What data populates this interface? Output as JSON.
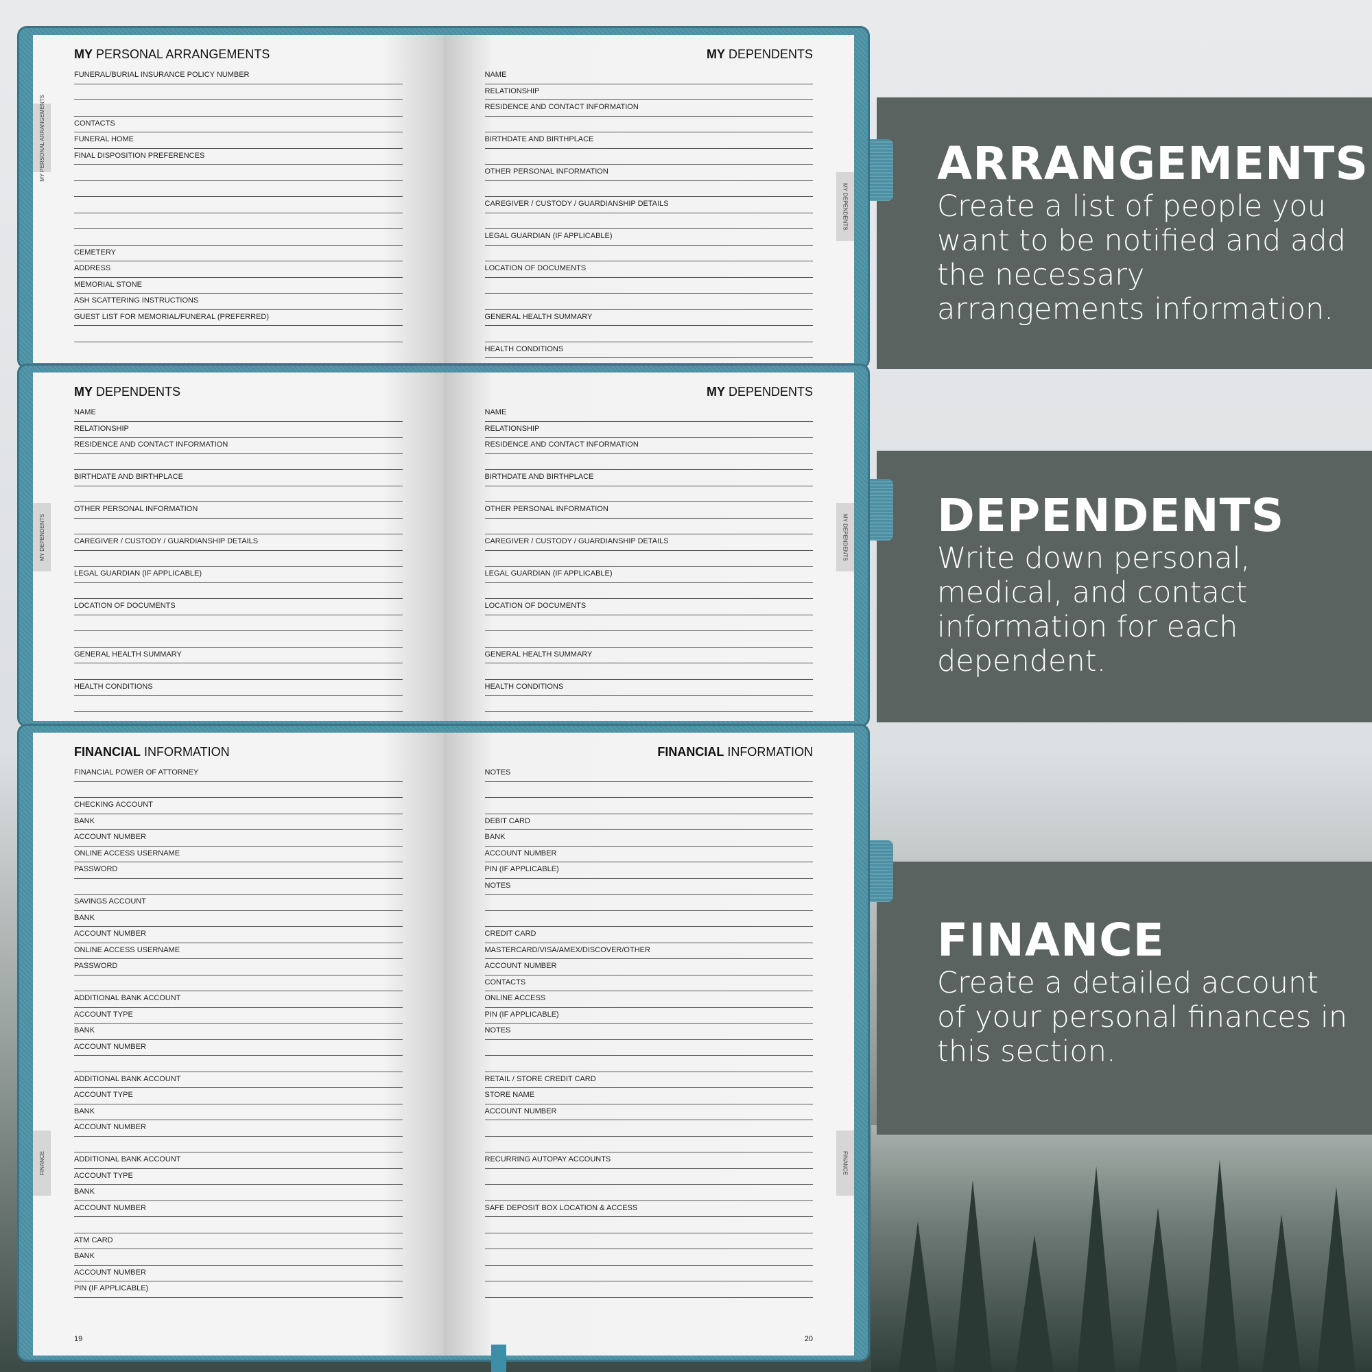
{
  "panels": [
    {
      "title": "ARRANGEMENTS",
      "text": "Create a list of people you want to be notified and add the necessary arrangements information."
    },
    {
      "title": "DEPENDENTS",
      "text": "Write down personal, medical, and contact information for each dependent."
    },
    {
      "title": "FINANCE",
      "text": "Create a detailed account of your personal finances in this section."
    }
  ],
  "spread1": {
    "left": {
      "title_bold": "MY",
      "title_rest": " PERSONAL ARRANGEMENTS",
      "side": "MY PERSONAL ARRANGEMENTS",
      "fields": [
        "FUNERAL/BURIAL INSURANCE POLICY NUMBER",
        "",
        "",
        "CONTACTS",
        "FUNERAL HOME",
        "FINAL DISPOSITION PREFERENCES",
        "",
        "",
        "",
        "",
        "",
        "CEMETERY",
        "ADDRESS",
        "MEMORIAL STONE",
        "ASH SCATTERING INSTRUCTIONS",
        "GUEST LIST FOR MEMORIAL/FUNERAL (PREFERRED)",
        ""
      ]
    },
    "right": {
      "title_bold": "MY",
      "title_rest": " DEPENDENTS",
      "side": "MY DEPENDENTS",
      "fields": [
        "NAME",
        "RELATIONSHIP",
        "RESIDENCE AND CONTACT INFORMATION",
        "",
        "BIRTHDATE AND BIRTHPLACE",
        "",
        "OTHER PERSONAL INFORMATION",
        "",
        "CAREGIVER / CUSTODY / GUARDIANSHIP DETAILS",
        "",
        "LEGAL GUARDIAN (IF APPLICABLE)",
        "",
        "LOCATION OF DOCUMENTS",
        "",
        "",
        "GENERAL HEALTH SUMMARY",
        "",
        "HEALTH CONDITIONS"
      ]
    }
  },
  "spread2": {
    "left": {
      "title_bold": "MY",
      "title_rest": " DEPENDENTS",
      "side": "MY DEPENDENTS",
      "fields": [
        "NAME",
        "RELATIONSHIP",
        "RESIDENCE AND CONTACT INFORMATION",
        "",
        "BIRTHDATE AND BIRTHPLACE",
        "",
        "OTHER PERSONAL INFORMATION",
        "",
        "CAREGIVER / CUSTODY / GUARDIANSHIP DETAILS",
        "",
        "LEGAL GUARDIAN (IF APPLICABLE)",
        "",
        "LOCATION OF DOCUMENTS",
        "",
        "",
        "GENERAL HEALTH SUMMARY",
        "",
        "HEALTH CONDITIONS",
        ""
      ]
    },
    "right": {
      "title_bold": "MY",
      "title_rest": " DEPENDENTS",
      "side": "MY DEPENDENTS",
      "fields": [
        "NAME",
        "RELATIONSHIP",
        "RESIDENCE AND CONTACT INFORMATION",
        "",
        "BIRTHDATE AND BIRTHPLACE",
        "",
        "OTHER PERSONAL INFORMATION",
        "",
        "CAREGIVER / CUSTODY / GUARDIANSHIP DETAILS",
        "",
        "LEGAL GUARDIAN (IF APPLICABLE)",
        "",
        "LOCATION OF DOCUMENTS",
        "",
        "",
        "GENERAL HEALTH SUMMARY",
        "",
        "HEALTH CONDITIONS",
        ""
      ]
    }
  },
  "spread3": {
    "left": {
      "title_bold": "FINANCIAL",
      "title_rest": " INFORMATION",
      "side": "FINANCE",
      "page_number": "19",
      "fields": [
        "FINANCIAL POWER OF ATTORNEY",
        "",
        "CHECKING ACCOUNT",
        "BANK",
        "ACCOUNT NUMBER",
        "ONLINE ACCESS USERNAME",
        "PASSWORD",
        "",
        "SAVINGS ACCOUNT",
        "BANK",
        "ACCOUNT NUMBER",
        "ONLINE ACCESS USERNAME",
        "PASSWORD",
        "",
        "ADDITIONAL BANK ACCOUNT",
        "ACCOUNT TYPE",
        "BANK",
        "ACCOUNT NUMBER",
        "",
        "ADDITIONAL BANK ACCOUNT",
        "ACCOUNT TYPE",
        "BANK",
        "ACCOUNT NUMBER",
        "",
        "ADDITIONAL BANK ACCOUNT",
        "ACCOUNT TYPE",
        "BANK",
        "ACCOUNT NUMBER",
        "",
        "ATM CARD",
        "BANK",
        "ACCOUNT NUMBER",
        "PIN (IF APPLICABLE)"
      ]
    },
    "right": {
      "title_bold": "FINANCIAL",
      "title_rest": " INFORMATION",
      "side": "FINANCE",
      "page_number": "20",
      "fields": [
        "NOTES",
        "",
        "",
        "DEBIT CARD",
        "BANK",
        "ACCOUNT NUMBER",
        "PIN (IF APPLICABLE)",
        "NOTES",
        "",
        "",
        "CREDIT CARD",
        "MASTERCARD/VISA/AMEX/DISCOVER/OTHER",
        "ACCOUNT NUMBER",
        "CONTACTS",
        "ONLINE ACCESS",
        "PIN (IF APPLICABLE)",
        "NOTES",
        "",
        "",
        "RETAIL / STORE CREDIT CARD",
        "STORE NAME",
        "ACCOUNT NUMBER",
        "",
        "",
        "RECURRING AUTOPAY ACCOUNTS",
        "",
        "",
        "SAFE DEPOSIT BOX LOCATION & ACCESS",
        "",
        "",
        "",
        "",
        ""
      ]
    }
  }
}
